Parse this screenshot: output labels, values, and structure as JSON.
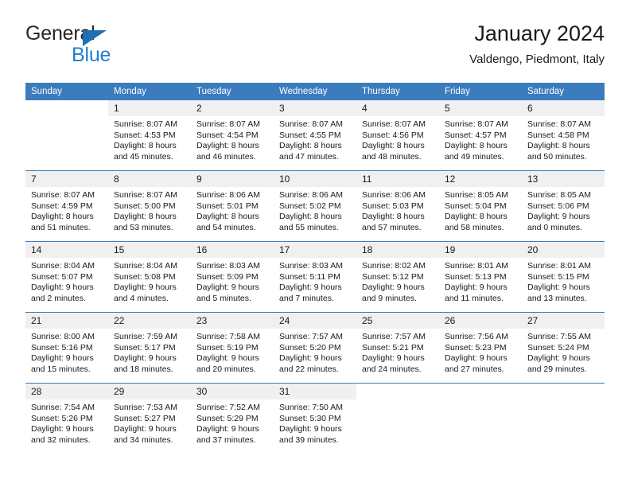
{
  "brand": {
    "name_top": "General",
    "name_bottom": "Blue",
    "accent_color": "#1f7fd0",
    "triangle_color": "#1f6fb5"
  },
  "header": {
    "title": "January 2024",
    "subtitle": "Valdengo, Piedmont, Italy"
  },
  "theme": {
    "header_bg": "#3a7cbe",
    "header_text": "#ffffff",
    "daynum_bg": "#f0f0f0",
    "separator": "#3a7cbe"
  },
  "weekday_headers": [
    "Sunday",
    "Monday",
    "Tuesday",
    "Wednesday",
    "Thursday",
    "Friday",
    "Saturday"
  ],
  "weeks": [
    [
      {
        "day": "",
        "sunrise": "",
        "sunset": "",
        "daylight_1": "",
        "daylight_2": ""
      },
      {
        "day": "1",
        "sunrise": "Sunrise: 8:07 AM",
        "sunset": "Sunset: 4:53 PM",
        "daylight_1": "Daylight: 8 hours",
        "daylight_2": "and 45 minutes."
      },
      {
        "day": "2",
        "sunrise": "Sunrise: 8:07 AM",
        "sunset": "Sunset: 4:54 PM",
        "daylight_1": "Daylight: 8 hours",
        "daylight_2": "and 46 minutes."
      },
      {
        "day": "3",
        "sunrise": "Sunrise: 8:07 AM",
        "sunset": "Sunset: 4:55 PM",
        "daylight_1": "Daylight: 8 hours",
        "daylight_2": "and 47 minutes."
      },
      {
        "day": "4",
        "sunrise": "Sunrise: 8:07 AM",
        "sunset": "Sunset: 4:56 PM",
        "daylight_1": "Daylight: 8 hours",
        "daylight_2": "and 48 minutes."
      },
      {
        "day": "5",
        "sunrise": "Sunrise: 8:07 AM",
        "sunset": "Sunset: 4:57 PM",
        "daylight_1": "Daylight: 8 hours",
        "daylight_2": "and 49 minutes."
      },
      {
        "day": "6",
        "sunrise": "Sunrise: 8:07 AM",
        "sunset": "Sunset: 4:58 PM",
        "daylight_1": "Daylight: 8 hours",
        "daylight_2": "and 50 minutes."
      }
    ],
    [
      {
        "day": "7",
        "sunrise": "Sunrise: 8:07 AM",
        "sunset": "Sunset: 4:59 PM",
        "daylight_1": "Daylight: 8 hours",
        "daylight_2": "and 51 minutes."
      },
      {
        "day": "8",
        "sunrise": "Sunrise: 8:07 AM",
        "sunset": "Sunset: 5:00 PM",
        "daylight_1": "Daylight: 8 hours",
        "daylight_2": "and 53 minutes."
      },
      {
        "day": "9",
        "sunrise": "Sunrise: 8:06 AM",
        "sunset": "Sunset: 5:01 PM",
        "daylight_1": "Daylight: 8 hours",
        "daylight_2": "and 54 minutes."
      },
      {
        "day": "10",
        "sunrise": "Sunrise: 8:06 AM",
        "sunset": "Sunset: 5:02 PM",
        "daylight_1": "Daylight: 8 hours",
        "daylight_2": "and 55 minutes."
      },
      {
        "day": "11",
        "sunrise": "Sunrise: 8:06 AM",
        "sunset": "Sunset: 5:03 PM",
        "daylight_1": "Daylight: 8 hours",
        "daylight_2": "and 57 minutes."
      },
      {
        "day": "12",
        "sunrise": "Sunrise: 8:05 AM",
        "sunset": "Sunset: 5:04 PM",
        "daylight_1": "Daylight: 8 hours",
        "daylight_2": "and 58 minutes."
      },
      {
        "day": "13",
        "sunrise": "Sunrise: 8:05 AM",
        "sunset": "Sunset: 5:06 PM",
        "daylight_1": "Daylight: 9 hours",
        "daylight_2": "and 0 minutes."
      }
    ],
    [
      {
        "day": "14",
        "sunrise": "Sunrise: 8:04 AM",
        "sunset": "Sunset: 5:07 PM",
        "daylight_1": "Daylight: 9 hours",
        "daylight_2": "and 2 minutes."
      },
      {
        "day": "15",
        "sunrise": "Sunrise: 8:04 AM",
        "sunset": "Sunset: 5:08 PM",
        "daylight_1": "Daylight: 9 hours",
        "daylight_2": "and 4 minutes."
      },
      {
        "day": "16",
        "sunrise": "Sunrise: 8:03 AM",
        "sunset": "Sunset: 5:09 PM",
        "daylight_1": "Daylight: 9 hours",
        "daylight_2": "and 5 minutes."
      },
      {
        "day": "17",
        "sunrise": "Sunrise: 8:03 AM",
        "sunset": "Sunset: 5:11 PM",
        "daylight_1": "Daylight: 9 hours",
        "daylight_2": "and 7 minutes."
      },
      {
        "day": "18",
        "sunrise": "Sunrise: 8:02 AM",
        "sunset": "Sunset: 5:12 PM",
        "daylight_1": "Daylight: 9 hours",
        "daylight_2": "and 9 minutes."
      },
      {
        "day": "19",
        "sunrise": "Sunrise: 8:01 AM",
        "sunset": "Sunset: 5:13 PM",
        "daylight_1": "Daylight: 9 hours",
        "daylight_2": "and 11 minutes."
      },
      {
        "day": "20",
        "sunrise": "Sunrise: 8:01 AM",
        "sunset": "Sunset: 5:15 PM",
        "daylight_1": "Daylight: 9 hours",
        "daylight_2": "and 13 minutes."
      }
    ],
    [
      {
        "day": "21",
        "sunrise": "Sunrise: 8:00 AM",
        "sunset": "Sunset: 5:16 PM",
        "daylight_1": "Daylight: 9 hours",
        "daylight_2": "and 15 minutes."
      },
      {
        "day": "22",
        "sunrise": "Sunrise: 7:59 AM",
        "sunset": "Sunset: 5:17 PM",
        "daylight_1": "Daylight: 9 hours",
        "daylight_2": "and 18 minutes."
      },
      {
        "day": "23",
        "sunrise": "Sunrise: 7:58 AM",
        "sunset": "Sunset: 5:19 PM",
        "daylight_1": "Daylight: 9 hours",
        "daylight_2": "and 20 minutes."
      },
      {
        "day": "24",
        "sunrise": "Sunrise: 7:57 AM",
        "sunset": "Sunset: 5:20 PM",
        "daylight_1": "Daylight: 9 hours",
        "daylight_2": "and 22 minutes."
      },
      {
        "day": "25",
        "sunrise": "Sunrise: 7:57 AM",
        "sunset": "Sunset: 5:21 PM",
        "daylight_1": "Daylight: 9 hours",
        "daylight_2": "and 24 minutes."
      },
      {
        "day": "26",
        "sunrise": "Sunrise: 7:56 AM",
        "sunset": "Sunset: 5:23 PM",
        "daylight_1": "Daylight: 9 hours",
        "daylight_2": "and 27 minutes."
      },
      {
        "day": "27",
        "sunrise": "Sunrise: 7:55 AM",
        "sunset": "Sunset: 5:24 PM",
        "daylight_1": "Daylight: 9 hours",
        "daylight_2": "and 29 minutes."
      }
    ],
    [
      {
        "day": "28",
        "sunrise": "Sunrise: 7:54 AM",
        "sunset": "Sunset: 5:26 PM",
        "daylight_1": "Daylight: 9 hours",
        "daylight_2": "and 32 minutes."
      },
      {
        "day": "29",
        "sunrise": "Sunrise: 7:53 AM",
        "sunset": "Sunset: 5:27 PM",
        "daylight_1": "Daylight: 9 hours",
        "daylight_2": "and 34 minutes."
      },
      {
        "day": "30",
        "sunrise": "Sunrise: 7:52 AM",
        "sunset": "Sunset: 5:29 PM",
        "daylight_1": "Daylight: 9 hours",
        "daylight_2": "and 37 minutes."
      },
      {
        "day": "31",
        "sunrise": "Sunrise: 7:50 AM",
        "sunset": "Sunset: 5:30 PM",
        "daylight_1": "Daylight: 9 hours",
        "daylight_2": "and 39 minutes."
      },
      {
        "day": "",
        "sunrise": "",
        "sunset": "",
        "daylight_1": "",
        "daylight_2": ""
      },
      {
        "day": "",
        "sunrise": "",
        "sunset": "",
        "daylight_1": "",
        "daylight_2": ""
      },
      {
        "day": "",
        "sunrise": "",
        "sunset": "",
        "daylight_1": "",
        "daylight_2": ""
      }
    ]
  ]
}
